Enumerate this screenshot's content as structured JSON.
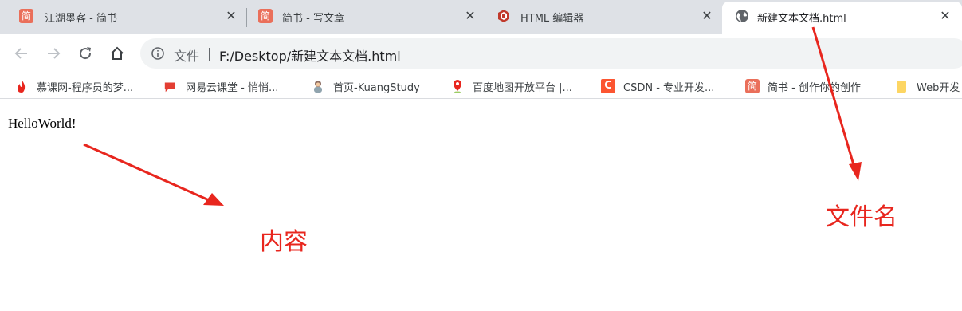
{
  "tabs": [
    {
      "title": "江湖墨客 - 简书",
      "icon": "jianshu-icon",
      "icon_glyph": "简",
      "active": false
    },
    {
      "title": "简书 - 写文章",
      "icon": "jianshu-icon",
      "icon_glyph": "简",
      "active": false
    },
    {
      "title": "HTML 编辑器",
      "icon": "html-logo-icon",
      "active": false
    },
    {
      "title": "新建文本文档.html",
      "icon": "globe-icon",
      "active": true
    }
  ],
  "toolbar": {
    "scheme_label": "文件",
    "divider": "|",
    "url": "F:/Desktop/新建文本文档.html"
  },
  "bookmarks": [
    {
      "label": "慕课网-程序员的梦...",
      "icon": "flame-icon"
    },
    {
      "label": "网易云课堂 - 悄悄...",
      "icon": "netease-study-icon"
    },
    {
      "label": "首页-KuangStudy",
      "icon": "avatar-icon"
    },
    {
      "label": "百度地图开放平台 |...",
      "icon": "map-pin-icon"
    },
    {
      "label": "CSDN - 专业开发...",
      "icon": "csdn-icon",
      "icon_glyph": "C"
    },
    {
      "label": "简书 - 创作你的创作",
      "icon": "jianshu-icon",
      "icon_glyph": "简"
    },
    {
      "label": "Web开发",
      "icon": "folder-icon"
    }
  ],
  "page": {
    "body_text": "HelloWorld!"
  },
  "annotations": {
    "content_label": "内容",
    "filename_label": "文件名",
    "color": "#e8261e"
  },
  "colors": {
    "tabstrip_bg": "#dee1e6",
    "omnibox_bg": "#f1f3f4",
    "jianshu_brand": "#ea6f5a",
    "csdn_brand": "#fc5531"
  }
}
